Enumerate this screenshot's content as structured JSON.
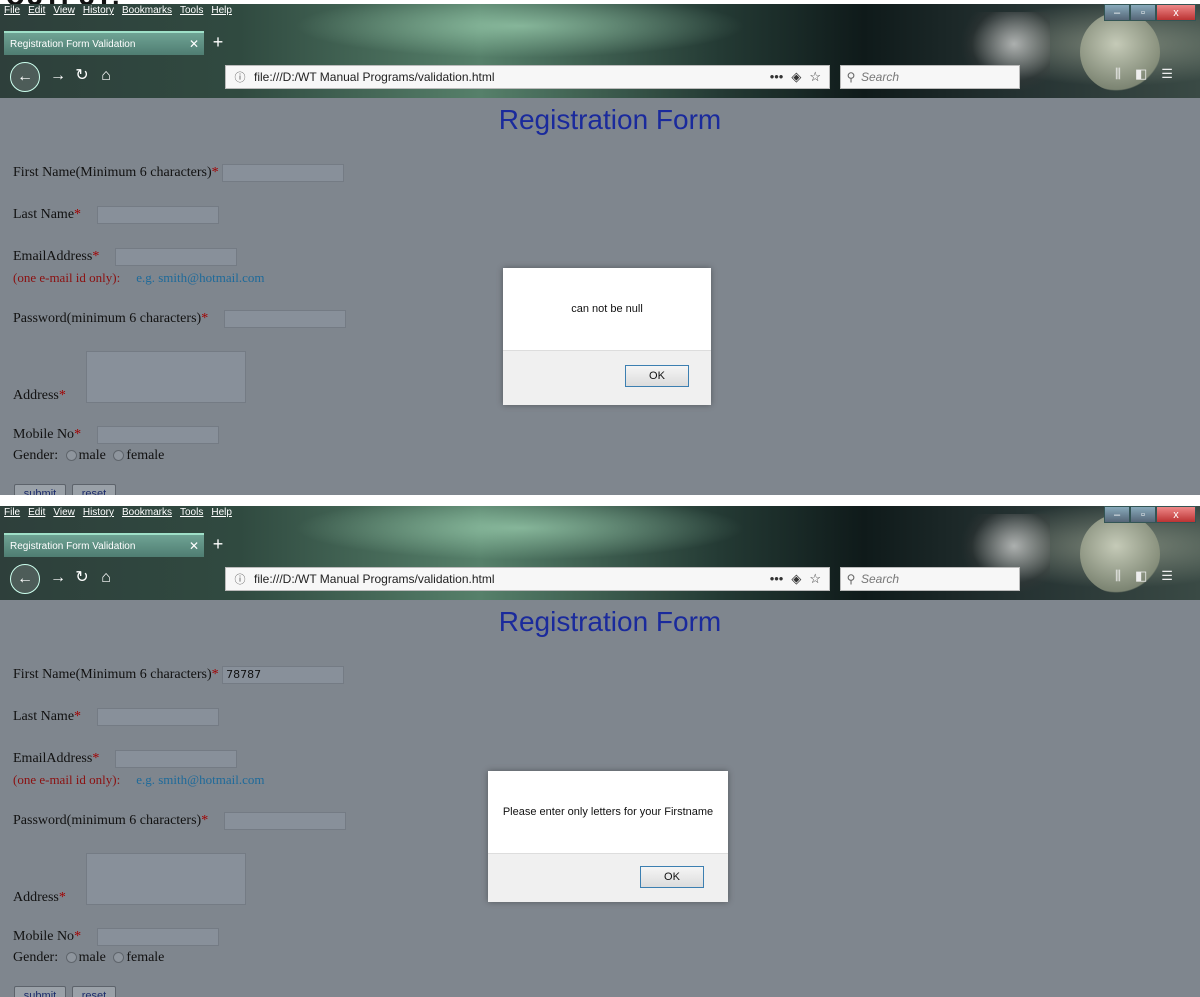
{
  "heading_fragment": "OUTPUT:",
  "screens": [
    {
      "menu": [
        "File",
        "Edit",
        "View",
        "History",
        "Bookmarks",
        "Tools",
        "Help"
      ],
      "tab_title": "Registration Form Validation",
      "url": "file:///D:/WT Manual Programs/validation.html",
      "search_placeholder": "Search",
      "form": {
        "title": "Registration Form",
        "first_name_label": "First Name(Minimum 6 characters)",
        "first_name_value": "",
        "last_name_label": "Last Name",
        "email_label": "EmailAddress",
        "email_note": "(one e-mail id only):",
        "email_example": "e.g. smith@hotmail.com",
        "password_label": "Password(minimum 6 characters)",
        "address_label": "Address",
        "mobile_label": "Mobile No",
        "gender_label": "Gender:",
        "gender_options": [
          "male",
          "female"
        ],
        "required_mark": "*",
        "submit_label": "submit",
        "reset_label": "reset"
      },
      "dialog": {
        "message": "can not be null",
        "ok_label": "OK"
      }
    },
    {
      "menu": [
        "File",
        "Edit",
        "View",
        "History",
        "Bookmarks",
        "Tools",
        "Help"
      ],
      "tab_title": "Registration Form Validation",
      "url": "file:///D:/WT Manual Programs/validation.html",
      "search_placeholder": "Search",
      "form": {
        "title": "Registration Form",
        "first_name_label": "First Name(Minimum 6 characters)",
        "first_name_value": "78787",
        "last_name_label": "Last Name",
        "email_label": "EmailAddress",
        "email_note": "(one e-mail id only):",
        "email_example": "e.g. smith@hotmail.com",
        "password_label": "Password(minimum 6 characters)",
        "address_label": "Address",
        "mobile_label": "Mobile No",
        "gender_label": "Gender:",
        "gender_options": [
          "male",
          "female"
        ],
        "required_mark": "*",
        "submit_label": "submit",
        "reset_label": "reset"
      },
      "dialog": {
        "message": "Please enter only letters for your Firstname",
        "ok_label": "OK"
      }
    }
  ]
}
